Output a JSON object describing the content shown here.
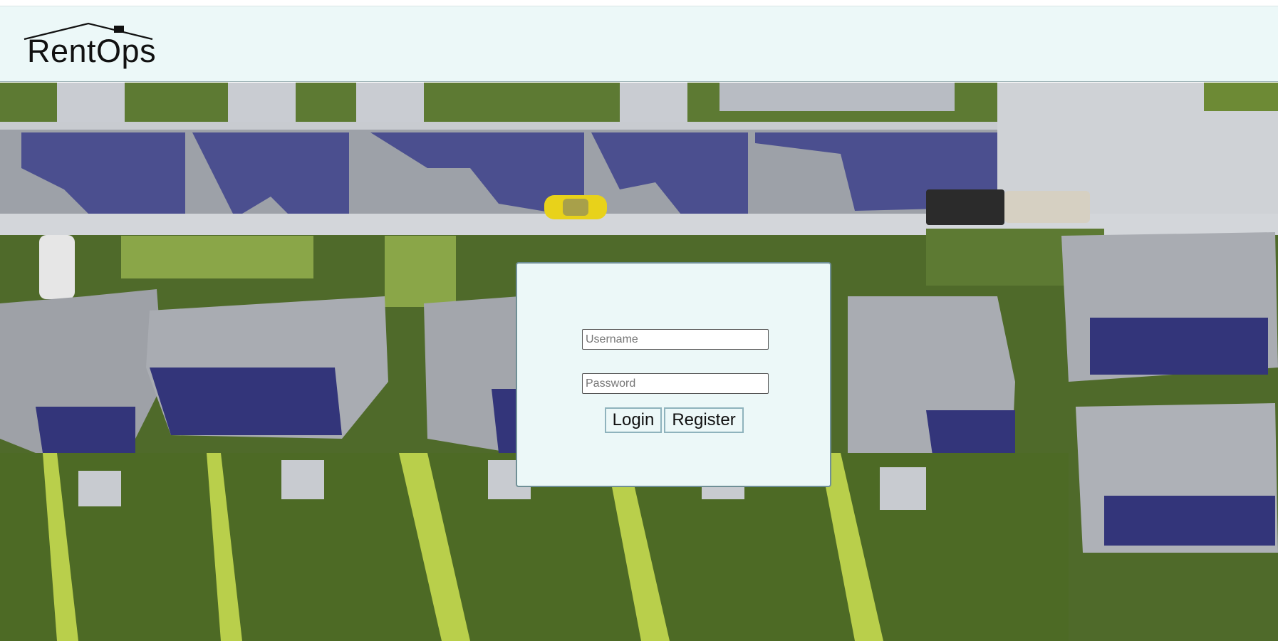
{
  "app": {
    "brand": "RentOps"
  },
  "login": {
    "username_placeholder": "Username",
    "password_placeholder": "Password",
    "username_value": "",
    "password_value": "",
    "login_label": "Login",
    "register_label": "Register"
  },
  "colors": {
    "panel_background": "#ecf8f8",
    "panel_border": "#6f8f96",
    "header_background": "#ecf8f8"
  },
  "icons": {
    "logo_roof": "house-roof-icon",
    "background": "aerial-neighborhood-photo"
  }
}
